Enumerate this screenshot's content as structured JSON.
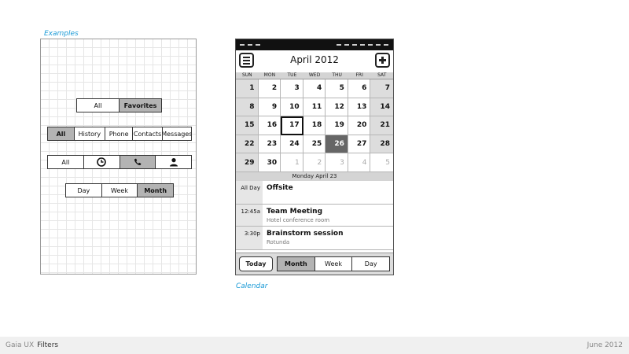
{
  "captions": {
    "examples": "Examples",
    "calendar": "Calendar"
  },
  "examples": {
    "favorites_filter": [
      "All",
      "Favorites"
    ],
    "history_filter": [
      "All",
      "History",
      "Phone",
      "Contacts",
      "Messages"
    ],
    "icon_filter": {
      "all_label": "All",
      "icons": [
        "clock-icon",
        "phone-icon",
        "person-icon"
      ]
    },
    "range_filter": [
      "Day",
      "Week",
      "Month"
    ]
  },
  "calendar": {
    "title": "April 2012",
    "weekdays": [
      "SUN",
      "MON",
      "TUE",
      "WED",
      "THU",
      "FRI",
      "SAT"
    ],
    "weeks": [
      [
        "1",
        "2",
        "3",
        "4",
        "5",
        "6",
        "7"
      ],
      [
        "8",
        "9",
        "10",
        "11",
        "12",
        "13",
        "14"
      ],
      [
        "15",
        "16",
        "17",
        "18",
        "19",
        "20",
        "21"
      ],
      [
        "22",
        "23",
        "24",
        "25",
        "26",
        "27",
        "28"
      ],
      [
        "29",
        "30",
        "1",
        "2",
        "3",
        "4",
        "5"
      ]
    ],
    "today": "17",
    "selected": "26",
    "day_header": "Monday April 23",
    "events": [
      {
        "time": "All Day",
        "title": "Offsite",
        "location": ""
      },
      {
        "time": "12:45a",
        "title": "Team Meeting",
        "location": "Hotel conference room"
      },
      {
        "time": "3:30p",
        "title": "Brainstorm session",
        "location": "Rotunda"
      }
    ],
    "footer": {
      "today_label": "Today",
      "views": [
        "Month",
        "Week",
        "Day"
      ],
      "selected_view": "Month"
    }
  },
  "bottom_bar": {
    "product": "Gaia UX",
    "section": "Filters",
    "date": "June 2012"
  },
  "colors": {
    "caption": "#1a9ad6",
    "selected_segment": "#b3b3b3",
    "selected_day": "#666666"
  }
}
